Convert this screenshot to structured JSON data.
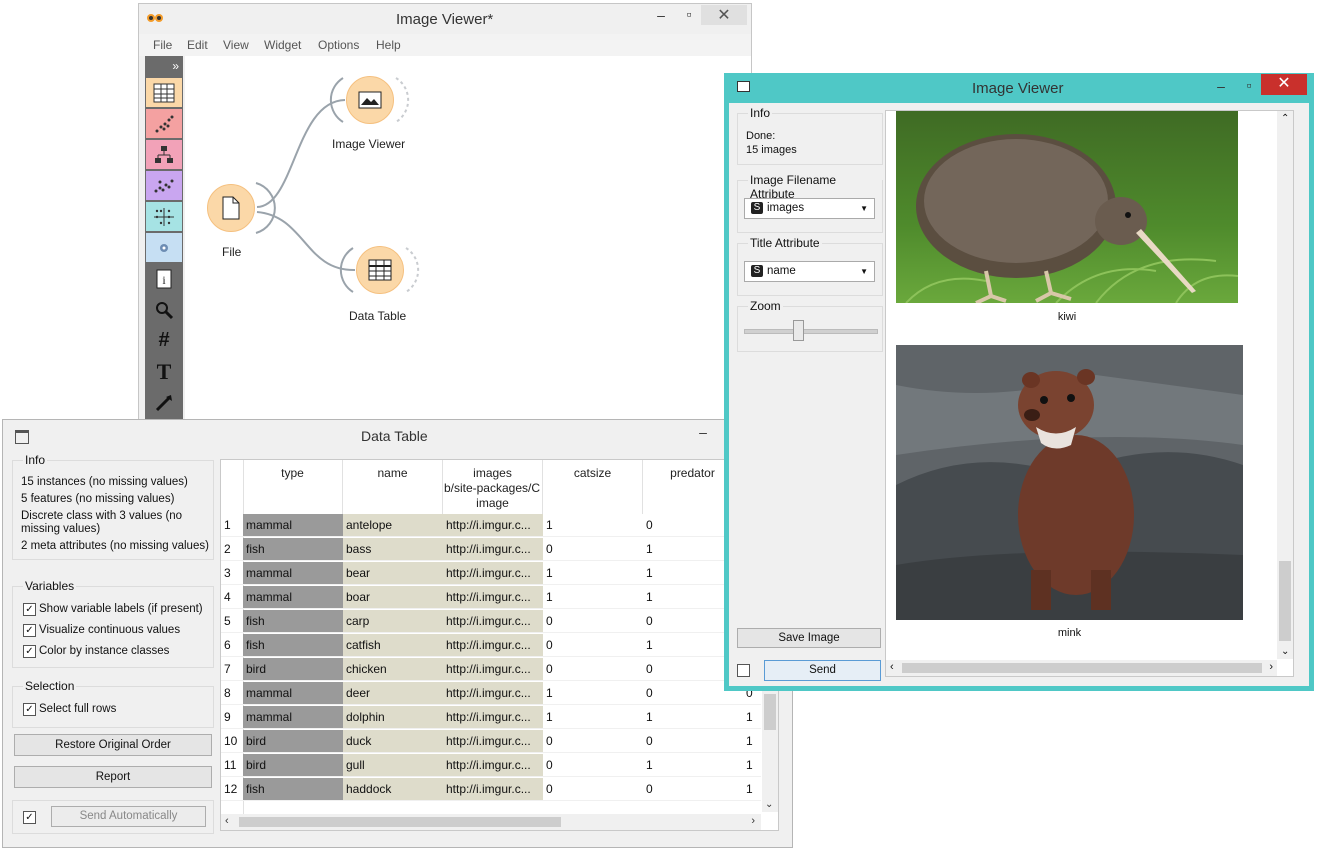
{
  "canvas_window": {
    "title": "Image Viewer*",
    "menu": [
      "File",
      "Edit",
      "View",
      "Widget",
      "Options",
      "Help"
    ],
    "toolbox_expand": "»",
    "nodes": {
      "file": "File",
      "image_viewer": "Image Viewer",
      "data_table": "Data Table"
    },
    "colors": {
      "node_fill": "#fbd8a8",
      "node_border": "#f5c07f",
      "link": "#9aa3ab"
    }
  },
  "data_table_window": {
    "title": "Data Table",
    "info": {
      "title": "Info",
      "lines": [
        "15 instances (no missing values)",
        "5 features (no missing values)",
        "Discrete class with 3 values (no",
        "missing values)",
        "2 meta attributes (no missing values)"
      ]
    },
    "variables": {
      "title": "Variables",
      "options": [
        {
          "label": "Show variable labels (if present)",
          "checked": true
        },
        {
          "label": "Visualize continuous values",
          "checked": true
        },
        {
          "label": "Color by instance classes",
          "checked": true
        }
      ]
    },
    "selection": {
      "title": "Selection",
      "option": {
        "label": "Select full rows",
        "checked": true
      }
    },
    "buttons": {
      "restore": "Restore Original Order",
      "report": "Report",
      "send_auto": "Send Automatically"
    },
    "columns": [
      {
        "name": "type",
        "sub": ""
      },
      {
        "name": "name",
        "sub": ""
      },
      {
        "name": "images",
        "sub": "b/site-packages/C",
        "sub2": "image"
      },
      {
        "name": "catsize",
        "sub": ""
      },
      {
        "name": "predator",
        "sub": ""
      }
    ],
    "rows": [
      {
        "n": "1",
        "type": "mammal",
        "name": "antelope",
        "images": "http://i.imgur.c...",
        "catsize": "1",
        "predator": "0",
        "extra": ""
      },
      {
        "n": "2",
        "type": "fish",
        "name": "bass",
        "images": "http://i.imgur.c...",
        "catsize": "0",
        "predator": "1",
        "extra": ""
      },
      {
        "n": "3",
        "type": "mammal",
        "name": "bear",
        "images": "http://i.imgur.c...",
        "catsize": "1",
        "predator": "1",
        "extra": ""
      },
      {
        "n": "4",
        "type": "mammal",
        "name": "boar",
        "images": "http://i.imgur.c...",
        "catsize": "1",
        "predator": "1",
        "extra": ""
      },
      {
        "n": "5",
        "type": "fish",
        "name": "carp",
        "images": "http://i.imgur.c...",
        "catsize": "0",
        "predator": "0",
        "extra": ""
      },
      {
        "n": "6",
        "type": "fish",
        "name": "catfish",
        "images": "http://i.imgur.c...",
        "catsize": "0",
        "predator": "1",
        "extra": ""
      },
      {
        "n": "7",
        "type": "bird",
        "name": "chicken",
        "images": "http://i.imgur.c...",
        "catsize": "0",
        "predator": "0",
        "extra": ""
      },
      {
        "n": "8",
        "type": "mammal",
        "name": "deer",
        "images": "http://i.imgur.c...",
        "catsize": "1",
        "predator": "0",
        "extra": "0"
      },
      {
        "n": "9",
        "type": "mammal",
        "name": "dolphin",
        "images": "http://i.imgur.c...",
        "catsize": "1",
        "predator": "1",
        "extra": "1"
      },
      {
        "n": "10",
        "type": "bird",
        "name": "duck",
        "images": "http://i.imgur.c...",
        "catsize": "0",
        "predator": "0",
        "extra": "1"
      },
      {
        "n": "11",
        "type": "bird",
        "name": "gull",
        "images": "http://i.imgur.c...",
        "catsize": "0",
        "predator": "1",
        "extra": "1"
      },
      {
        "n": "12",
        "type": "fish",
        "name": "haddock",
        "images": "http://i.imgur.c...",
        "catsize": "0",
        "predator": "0",
        "extra": "1"
      }
    ]
  },
  "image_viewer_window": {
    "title": "Image Viewer",
    "info": {
      "title": "Info",
      "status": "Done:",
      "count": "15 images"
    },
    "filename_attr": {
      "title": "Image Filename Attribute",
      "value": "images",
      "type_badge": "S"
    },
    "title_attr": {
      "title": "Title Attribute",
      "value": "name",
      "type_badge": "S"
    },
    "zoom": {
      "title": "Zoom",
      "level": 0.4
    },
    "buttons": {
      "save": "Save Image",
      "send": "Send"
    },
    "images": [
      {
        "caption": "kiwi"
      },
      {
        "caption": "mink"
      }
    ],
    "colors": {
      "frame": "#4fc8c6",
      "close": "#c9302c"
    }
  }
}
